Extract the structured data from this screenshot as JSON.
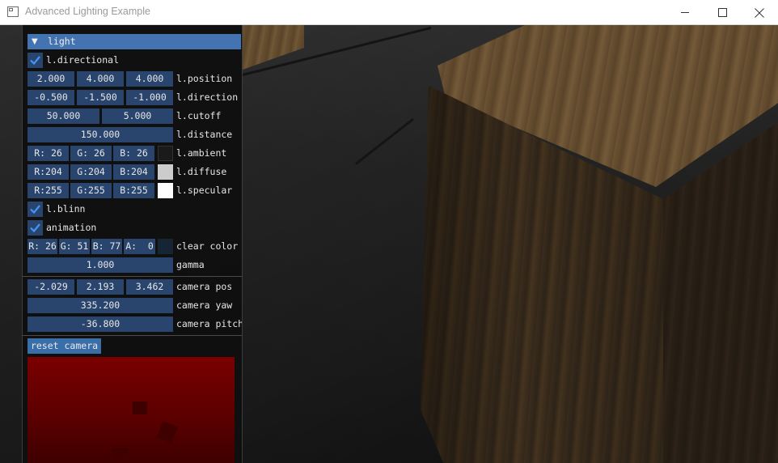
{
  "window": {
    "title": "Advanced Lighting Example",
    "minimize_icon": "minimize-icon",
    "maximize_icon": "maximize-icon",
    "close_icon": "close-icon"
  },
  "panel": {
    "header": "light",
    "directional": {
      "label": "l.directional",
      "checked": true
    },
    "position": {
      "values": [
        "2.000",
        "4.000",
        "4.000"
      ],
      "label": "l.position"
    },
    "direction": {
      "values": [
        "-0.500",
        "-1.500",
        "-1.000"
      ],
      "label": "l.direction"
    },
    "cutoff": {
      "values": [
        "50.000",
        "5.000"
      ],
      "label": "l.cutoff"
    },
    "distance": {
      "value": "150.000",
      "label": "l.distance"
    },
    "ambient": {
      "r": "R: 26",
      "g": "G: 26",
      "b": "B: 26",
      "color": "#1a1a1a",
      "label": "l.ambient"
    },
    "diffuse": {
      "r": "R:204",
      "g": "G:204",
      "b": "B:204",
      "color": "#cccccc",
      "label": "l.diffuse"
    },
    "specular": {
      "r": "R:255",
      "g": "G:255",
      "b": "B:255",
      "color": "#ffffff",
      "label": "l.specular"
    },
    "blinn": {
      "label": "l.blinn",
      "checked": true
    },
    "animation": {
      "label": "animation",
      "checked": true
    },
    "clear_color": {
      "r": "R: 26",
      "g": "G: 51",
      "b": "B: 77",
      "a": "A:  0",
      "color": "#1a334d",
      "label": "clear color"
    },
    "gamma": {
      "value": "1.000",
      "label": "gamma"
    },
    "camera_pos": {
      "values": [
        "-2.029",
        "2.193",
        "3.462"
      ],
      "label": "camera pos"
    },
    "camera_yaw": {
      "value": "335.200",
      "label": "camera yaw"
    },
    "camera_pitch": {
      "value": "-36.800",
      "label": "camera pitch"
    },
    "reset_button": "reset camera"
  },
  "colors": {
    "widget_bg": "#29456e",
    "header_bg": "#4373b1",
    "button_bg": "#3a6ea8",
    "check_mark": "#4296fa"
  }
}
